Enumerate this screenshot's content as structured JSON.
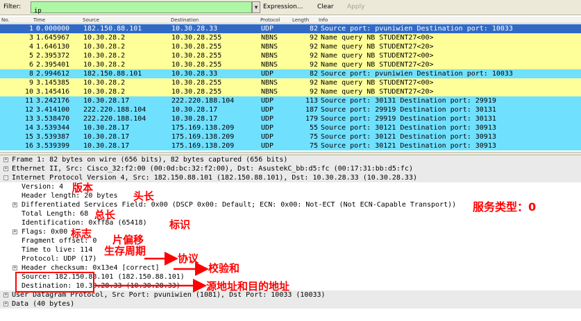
{
  "toolbar": {
    "filter_label": "Filter:",
    "filter_value": "ip",
    "expression_label": "Expression...",
    "clear_label": "Clear",
    "apply_label": "Apply"
  },
  "packet_list": {
    "columns": [
      "No.",
      "Time",
      "Source",
      "Destination",
      "Protocol",
      "Length",
      "Info"
    ],
    "row_colors": {
      "selected": "#316ac5",
      "udp": "#70e0ff",
      "nbns": "#ffff99"
    },
    "rows": [
      {
        "no": "1",
        "time": "0.000000",
        "src": "182.150.88.101",
        "dst": "10.30.28.33",
        "proto": "UDP",
        "len": "82",
        "info": "Source port: pvuniwien  Destination port: 10033",
        "kind": "selected"
      },
      {
        "no": "3",
        "time": "1.645967",
        "src": "10.30.28.2",
        "dst": "10.30.28.255",
        "proto": "NBNS",
        "len": "92",
        "info": "Name query NB STUDENT27<00>",
        "kind": "nbns"
      },
      {
        "no": "4",
        "time": "1.646130",
        "src": "10.30.28.2",
        "dst": "10.30.28.255",
        "proto": "NBNS",
        "len": "92",
        "info": "Name query NB STUDENT27<20>",
        "kind": "nbns"
      },
      {
        "no": "5",
        "time": "2.395372",
        "src": "10.30.28.2",
        "dst": "10.30.28.255",
        "proto": "NBNS",
        "len": "92",
        "info": "Name query NB STUDENT27<00>",
        "kind": "nbns"
      },
      {
        "no": "6",
        "time": "2.395401",
        "src": "10.30.28.2",
        "dst": "10.30.28.255",
        "proto": "NBNS",
        "len": "92",
        "info": "Name query NB STUDENT27<20>",
        "kind": "nbns"
      },
      {
        "no": "8",
        "time": "2.994612",
        "src": "182.150.88.101",
        "dst": "10.30.28.33",
        "proto": "UDP",
        "len": "82",
        "info": "Source port: pvuniwien  Destination port: 10033",
        "kind": "udp"
      },
      {
        "no": "9",
        "time": "3.145385",
        "src": "10.30.28.2",
        "dst": "10.30.28.255",
        "proto": "NBNS",
        "len": "92",
        "info": "Name query NB STUDENT27<00>",
        "kind": "nbns"
      },
      {
        "no": "10",
        "time": "3.145416",
        "src": "10.30.28.2",
        "dst": "10.30.28.255",
        "proto": "NBNS",
        "len": "92",
        "info": "Name query NB STUDENT27<20>",
        "kind": "nbns"
      },
      {
        "no": "11",
        "time": "3.242176",
        "src": "10.30.28.17",
        "dst": "222.220.188.104",
        "proto": "UDP",
        "len": "113",
        "info": "Source port: 30131  Destination port: 29919",
        "kind": "udp"
      },
      {
        "no": "12",
        "time": "3.414100",
        "src": "222.220.188.104",
        "dst": "10.30.28.17",
        "proto": "UDP",
        "len": "187",
        "info": "Source port: 29919  Destination port: 30131",
        "kind": "udp"
      },
      {
        "no": "13",
        "time": "3.538470",
        "src": "222.220.188.104",
        "dst": "10.30.28.17",
        "proto": "UDP",
        "len": "179",
        "info": "Source port: 29919  Destination port: 30131",
        "kind": "udp"
      },
      {
        "no": "14",
        "time": "3.539344",
        "src": "10.30.28.17",
        "dst": "175.169.138.209",
        "proto": "UDP",
        "len": "55",
        "info": "Source port: 30121  Destination port: 30913",
        "kind": "udp"
      },
      {
        "no": "15",
        "time": "3.539387",
        "src": "10.30.28.17",
        "dst": "175.169.138.209",
        "proto": "UDP",
        "len": "75",
        "info": "Source port: 30121  Destination port: 30913",
        "kind": "udp"
      },
      {
        "no": "16",
        "time": "3.539399",
        "src": "10.30.28.17",
        "dst": "175.169.138.209",
        "proto": "UDP",
        "len": "75",
        "info": "Source port: 30121  Destination port: 30913",
        "kind": "udp"
      }
    ]
  },
  "details": {
    "lines": [
      {
        "text": "Frame 1: 82 bytes on wire (656 bits), 82 bytes captured (656 bits)",
        "level": 0,
        "expander": "+"
      },
      {
        "text": "Ethernet II, Src: Cisco_32:f2:00 (00:0d:bc:32:f2:00), Dst: AsustekC_bb:d5:fc (00:17:31:bb:d5:fc)",
        "level": 0,
        "expander": "+"
      },
      {
        "text": "Internet Protocol Version 4, Src: 182.150.88.101 (182.150.88.101), Dst: 10.30.28.33 (10.30.28.33)",
        "level": 0,
        "expander": "-"
      },
      {
        "text": "Version: 4",
        "level": 1,
        "expander": ""
      },
      {
        "text": "Header length: 20 bytes",
        "level": 1,
        "expander": ""
      },
      {
        "text": "Differentiated Services Field: 0x00 (DSCP 0x00: Default; ECN: 0x00: Not-ECT (Not ECN-Capable Transport))",
        "level": 1,
        "expander": "+"
      },
      {
        "text": "Total Length: 68",
        "level": 1,
        "expander": ""
      },
      {
        "text": "Identification: 0xff8a (65418)",
        "level": 1,
        "expander": ""
      },
      {
        "text": "Flags: 0x00",
        "level": 1,
        "expander": "+"
      },
      {
        "text": "Fragment offset: 0",
        "level": 1,
        "expander": ""
      },
      {
        "text": "Time to live: 114",
        "level": 1,
        "expander": ""
      },
      {
        "text": "Protocol: UDP (17)",
        "level": 1,
        "expander": ""
      },
      {
        "text": "Header checksum: 0x13e4 [correct]",
        "level": 1,
        "expander": "+"
      },
      {
        "text": "Source: 182.150.88.101 (182.150.88.101)",
        "level": 1,
        "expander": ""
      },
      {
        "text": "Destination: 10.30.28.33 (10.30.28.33)",
        "level": 1,
        "expander": ""
      },
      {
        "text": "User Datagram Protocol, Src Port: pvuniwien (1081), Dst Port: 10033 (10033)",
        "level": 0,
        "expander": "+"
      },
      {
        "text": "Data (40 bytes)",
        "level": 0,
        "expander": "+"
      }
    ]
  },
  "annotations": {
    "version": "版本",
    "header_length": "头长",
    "service_type": "服务类型：0",
    "total_length": "总长",
    "identification": "标识",
    "flags": "标志",
    "fragment_offset": "片偏移",
    "ttl": "生存周期",
    "protocol": "协议",
    "checksum": "校验和",
    "addresses": "源地址和目的地址",
    "color": "#ff0000"
  }
}
